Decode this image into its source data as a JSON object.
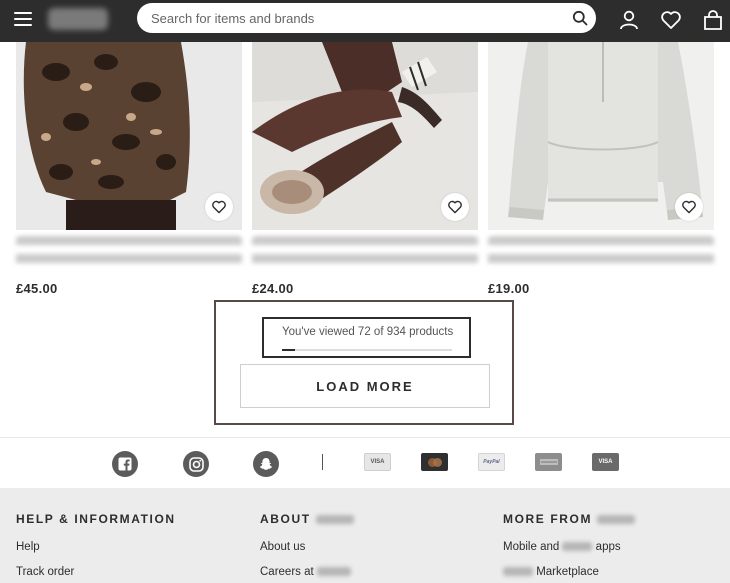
{
  "header": {
    "search_placeholder": "Search for items and brands"
  },
  "products": [
    {
      "price": "£45.00"
    },
    {
      "price": "£24.00"
    },
    {
      "price": "£19.00"
    }
  ],
  "progress": {
    "viewed_text": "You've viewed 72 of 934 products",
    "viewed": 72,
    "total": 934,
    "load_more_label": "LOAD MORE"
  },
  "social_icons": [
    "facebook-icon",
    "instagram-icon",
    "snapchat-icon"
  ],
  "payment_icons": [
    {
      "name": "visa-icon",
      "label": "VISA"
    },
    {
      "name": "mastercard-icon",
      "label": ""
    },
    {
      "name": "paypal-icon",
      "label": "PayPal"
    },
    {
      "name": "amex-icon",
      "label": ""
    },
    {
      "name": "visa-electron-icon",
      "label": "VISA"
    }
  ],
  "footer": {
    "help": {
      "heading": "HELP & INFORMATION",
      "links": [
        "Help",
        "Track order"
      ]
    },
    "about": {
      "heading": "ABOUT",
      "links": [
        "About us",
        "Careers at"
      ]
    },
    "more": {
      "heading": "MORE FROM",
      "link1_before": "Mobile and",
      "link1_after": "apps",
      "link2_after": "Marketplace"
    }
  },
  "colors": {
    "header_bg": "#2d2d2d",
    "footer_bg": "#ececec",
    "progress_border": "#5a4a45"
  }
}
